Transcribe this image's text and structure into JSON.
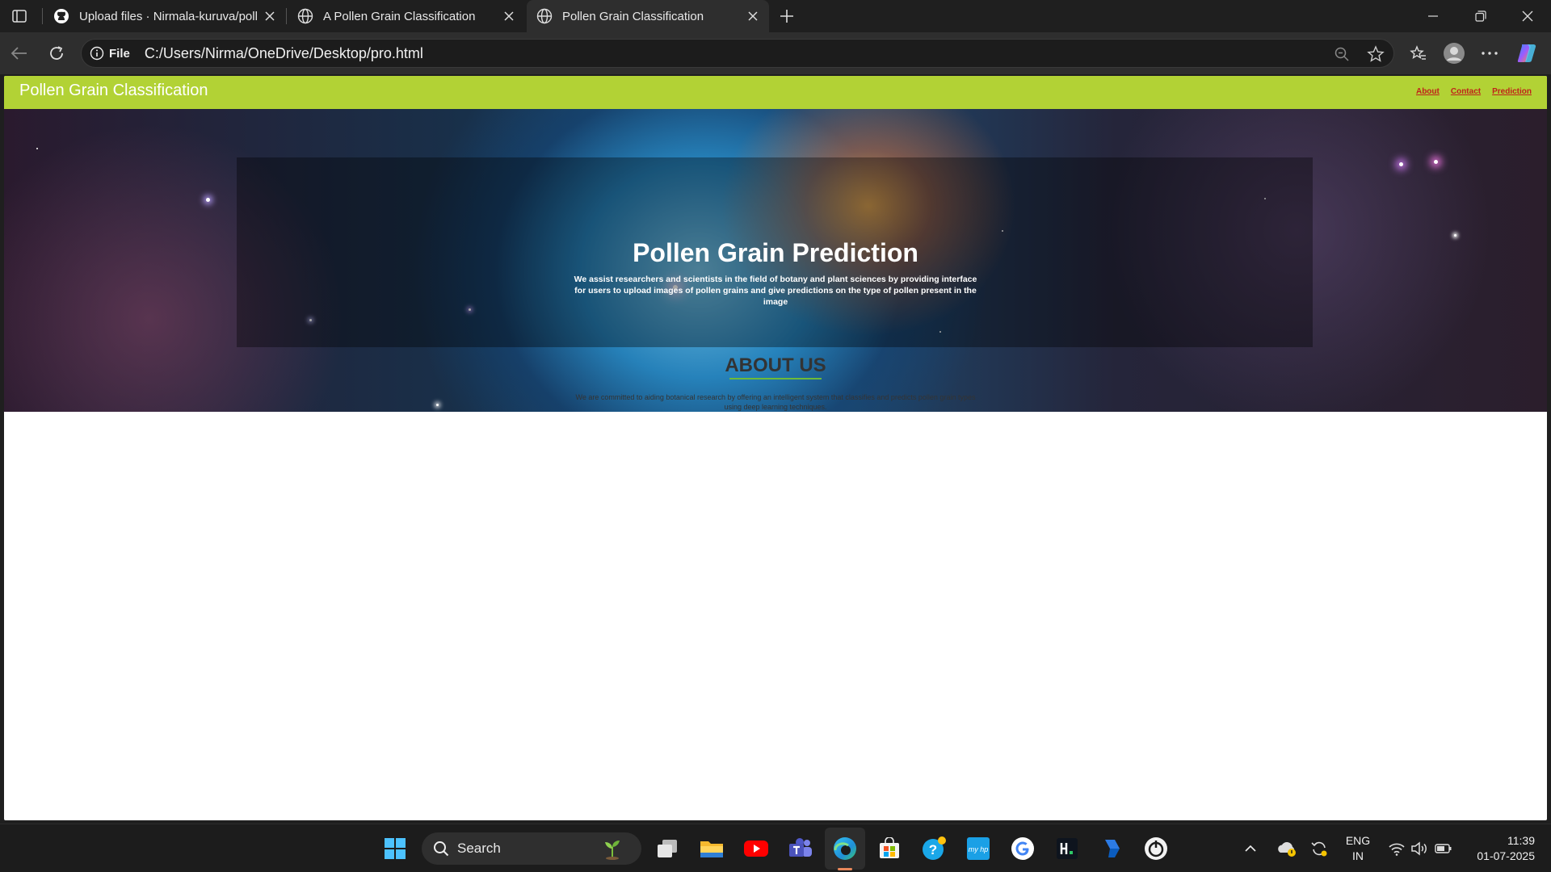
{
  "browser": {
    "tabs": [
      {
        "title": "Upload files · Nirmala-kuruva/poll",
        "icon": "github-icon"
      },
      {
        "title": "A Pollen Grain Classification",
        "icon": "globe-icon"
      },
      {
        "title": "Pollen Grain Classification",
        "icon": "globe-icon"
      }
    ],
    "address": {
      "chip": "File",
      "url": "C:/Users/Nirma/OneDrive/Desktop/pro.html"
    }
  },
  "site": {
    "brand": "Pollen Grain Classification",
    "nav": {
      "about": "About",
      "contact": "Contact",
      "prediction": "Prediction"
    },
    "hero": {
      "title": "Pollen Grain Prediction",
      "text": "We assist researchers and scientists in the field of botany and plant sciences by providing interface for users to upload images of pollen grains and give predictions on the type of pollen present in the image"
    },
    "about": {
      "title": "ABOUT US",
      "text": "We are committed to aiding botanical research by offering an intelligent system that classifies and predicts pollen grain types using deep learning techniques."
    },
    "colors": {
      "header": "#b2d235",
      "nav_link": "#c0221a",
      "about_rule": "#6cba3a"
    }
  },
  "taskbar": {
    "search_label": "Search",
    "language": {
      "line1": "ENG",
      "line2": "IN"
    },
    "time": "11:39",
    "date": "01-07-2025"
  }
}
